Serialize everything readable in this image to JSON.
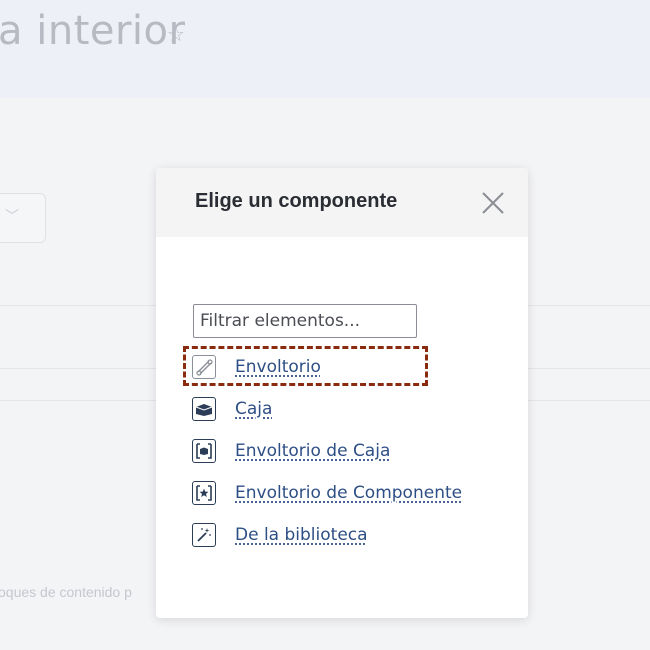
{
  "background": {
    "title": "a interior",
    "subtitle": "oques de contenido p"
  },
  "modal": {
    "title": "Elige un componente",
    "filter_placeholder": "Filtrar elementos...",
    "items": [
      {
        "label": "Envoltorio",
        "icon": "wrapper-icon"
      },
      {
        "label": "Caja",
        "icon": "box-icon"
      },
      {
        "label": "Envoltorio de Caja",
        "icon": "box-wrapper-icon"
      },
      {
        "label": "Envoltorio de Componente",
        "icon": "component-wrapper-icon"
      },
      {
        "label": "De la biblioteca",
        "icon": "magic-wand-icon"
      }
    ]
  },
  "colors": {
    "link": "#2e4f86",
    "highlight": "#8a2a0f",
    "icon": "#2c3e57"
  }
}
